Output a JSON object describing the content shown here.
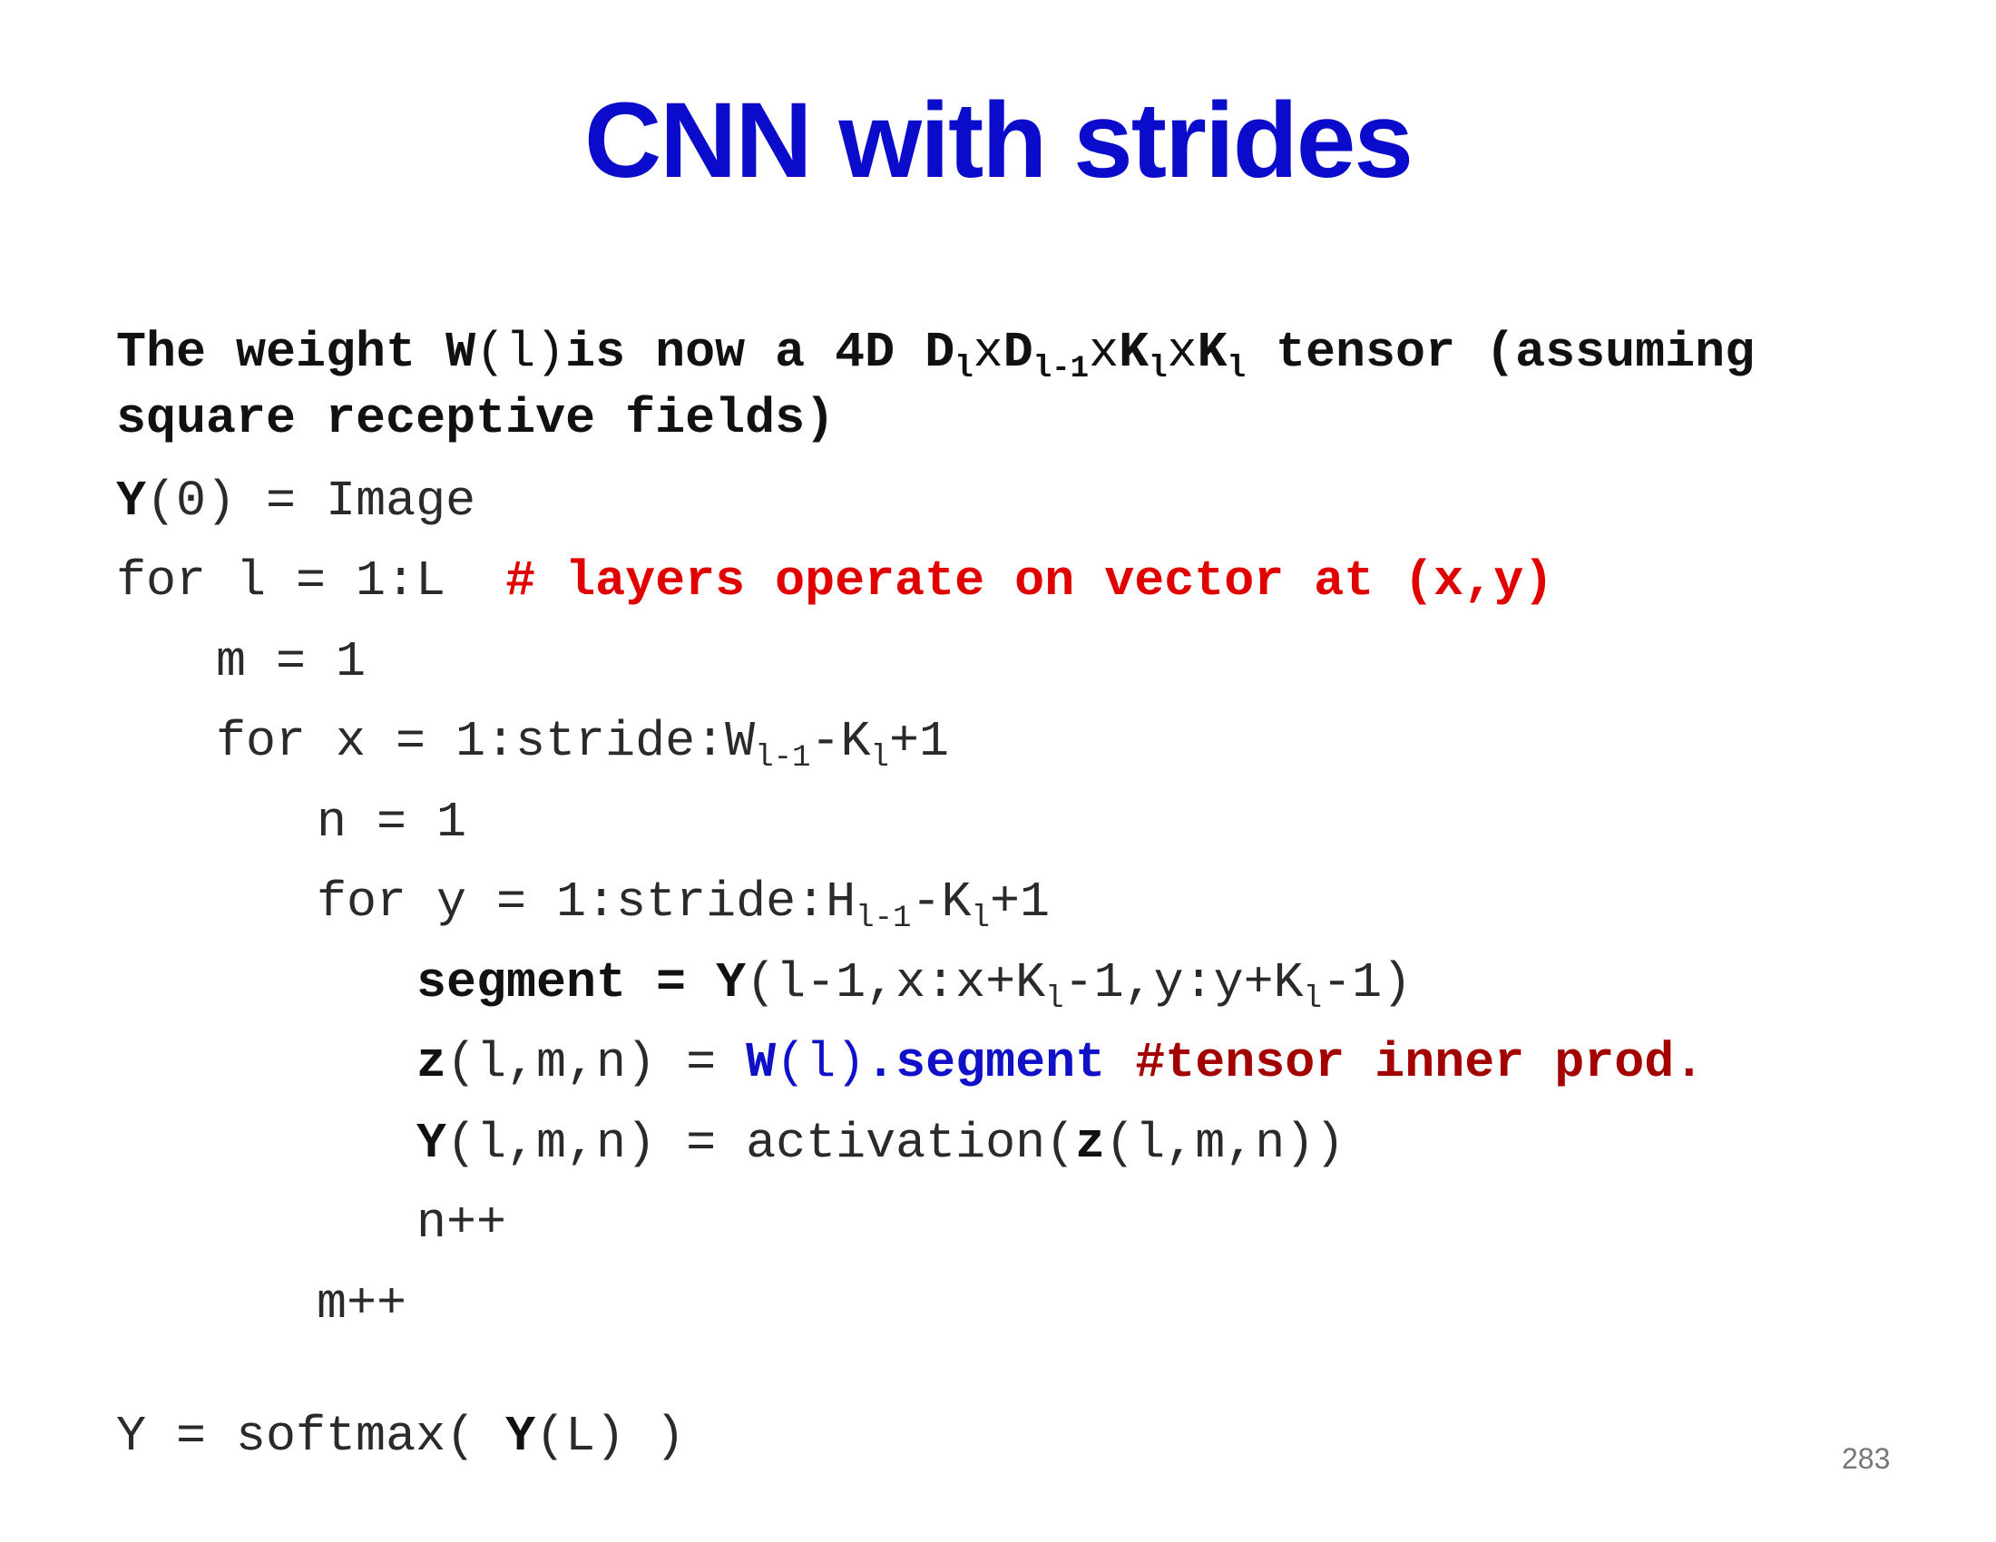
{
  "slide": {
    "title": "CNN with strides",
    "page_number": "283"
  },
  "intro": {
    "t1": "The weight ",
    "w": "W",
    "l_paren": "(l)",
    "t2": "is now a 4D ",
    "d": "D",
    "sub_l": "l",
    "x1": "x",
    "d2": "D",
    "sub_l1": "l-1",
    "x2": "x",
    "k1": "K",
    "sub_k1": "l",
    "x3": "x",
    "k2": "K",
    "sub_k2": "l",
    "t3": " tensor (assuming",
    "t4": "square receptive fields)"
  },
  "code": {
    "l1": {
      "y": "Y",
      "rest": "(0) = Image"
    },
    "l2": {
      "code": "for l = 1:L  ",
      "comment": "# layers operate on vector at (x,y)"
    },
    "l3": {
      "code": "m = 1"
    },
    "l4": {
      "a": "for x = 1:stride:W",
      "s1": "l-1",
      "b": "-K",
      "s2": "l",
      "c": "+1"
    },
    "l5": {
      "code": "n = 1"
    },
    "l6": {
      "a": "for y = 1:stride:H",
      "s1": "l-1",
      "b": "-K",
      "s2": "l",
      "c": "+1"
    },
    "l7": {
      "seg": "segment = ",
      "y": "Y",
      "a": "(l-1,x:x+K",
      "s1": "l",
      "b": "-1,y:y+K",
      "s2": "l",
      "c": "-1)"
    },
    "l8": {
      "z": "z",
      "a": "(l,m,n) = ",
      "w": "W",
      "wl": "(l)",
      "seg": ".segment ",
      "comment": "#tensor inner prod."
    },
    "l9": {
      "y": "Y",
      "a": "(l,m,n) = activation(",
      "z": "z",
      "b": "(l,m,n))"
    },
    "l10": {
      "code": "n++"
    },
    "l11": {
      "code": "m++"
    },
    "l12": {
      "a": "Y = softmax( ",
      "y": "Y",
      "b": "(L) )"
    }
  }
}
